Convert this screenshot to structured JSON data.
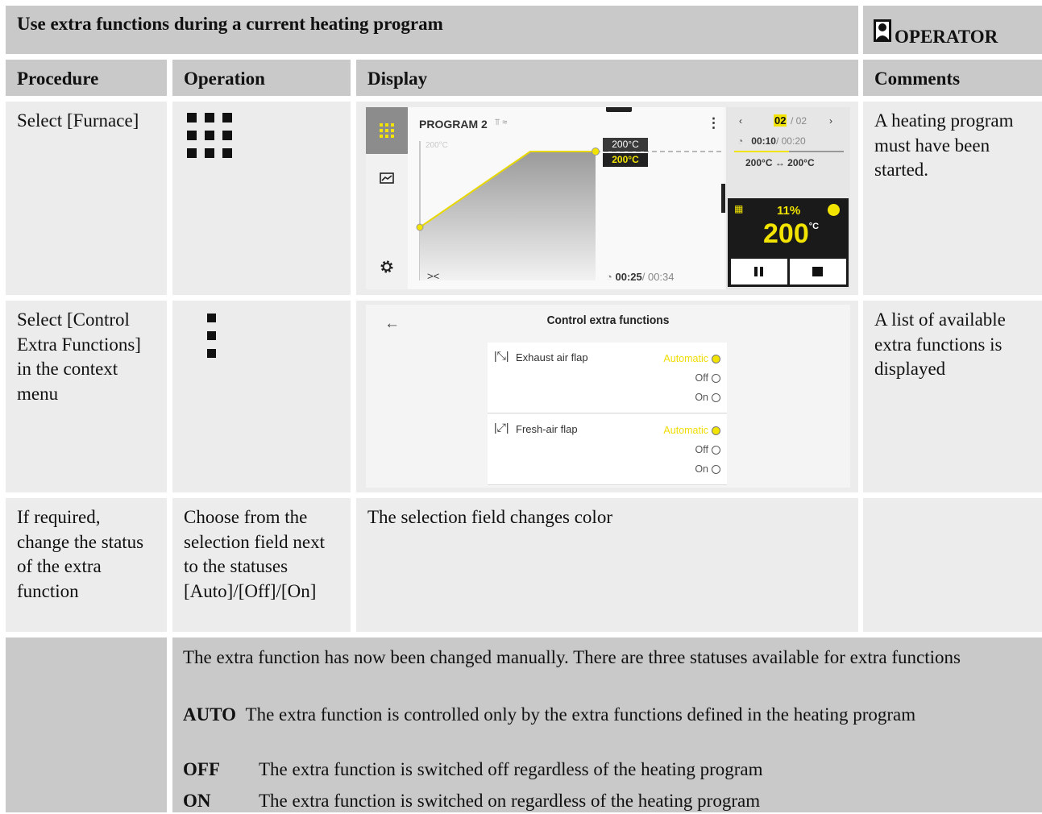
{
  "header": {
    "title": "Use extra functions during a current heating program",
    "role": "OPERATOR",
    "role_icon": "person-icon"
  },
  "columns": [
    "Procedure",
    "Operation",
    "Display",
    "Comments"
  ],
  "rows": [
    {
      "procedure": "Select [Furnace]",
      "operation_icon": "grid-3x3-icon",
      "comment": "A heating program must have been started."
    },
    {
      "procedure": "Select [Control Extra Functions] in the context menu",
      "operation_icon": "vertical-dots-icon",
      "comment": "A list of available extra functions is displayed"
    },
    {
      "procedure": "If required, change the status of the extra function",
      "operation": "Choose from the selection field next to the statuses [Auto]/[Off]/[On]",
      "display": "The selection field changes color",
      "comment": ""
    }
  ],
  "display1": {
    "program": "PROGRAM 2",
    "axis_label": "200°C",
    "setpoint_1": "200°C",
    "setpoint_2": "200°C",
    "segment_current": "02",
    "segment_total": "/ 02",
    "segment_time_elapsed": "00:10",
    "segment_time_total": "/ 00:20",
    "segment_range": "200°C ↔ 200°C",
    "power": "11%",
    "temperature": "200",
    "temperature_unit": "°C",
    "total_time_elapsed": "00:25",
    "total_time_total": "/ 00:34",
    "accent": "#f2e400"
  },
  "display2": {
    "title": "Control extra functions",
    "functions": [
      {
        "name": "Exhaust air flap",
        "options": [
          "Automatic",
          "Off",
          "On"
        ],
        "selected": "Automatic"
      },
      {
        "name": "Fresh-air flap",
        "options": [
          "Automatic",
          "Off",
          "On"
        ],
        "selected": "Automatic"
      }
    ]
  },
  "note": {
    "intro": "The extra function has now been changed manually. There are three statuses available for extra functions",
    "statuses": [
      {
        "key": "AUTO",
        "text": "The extra function is controlled only by the extra functions defined in the heating program"
      },
      {
        "key": "OFF",
        "text": "The extra function is switched off regardless of the heating program"
      },
      {
        "key": "ON",
        "text": "The extra function is switched on regardless of the heating program"
      }
    ]
  }
}
